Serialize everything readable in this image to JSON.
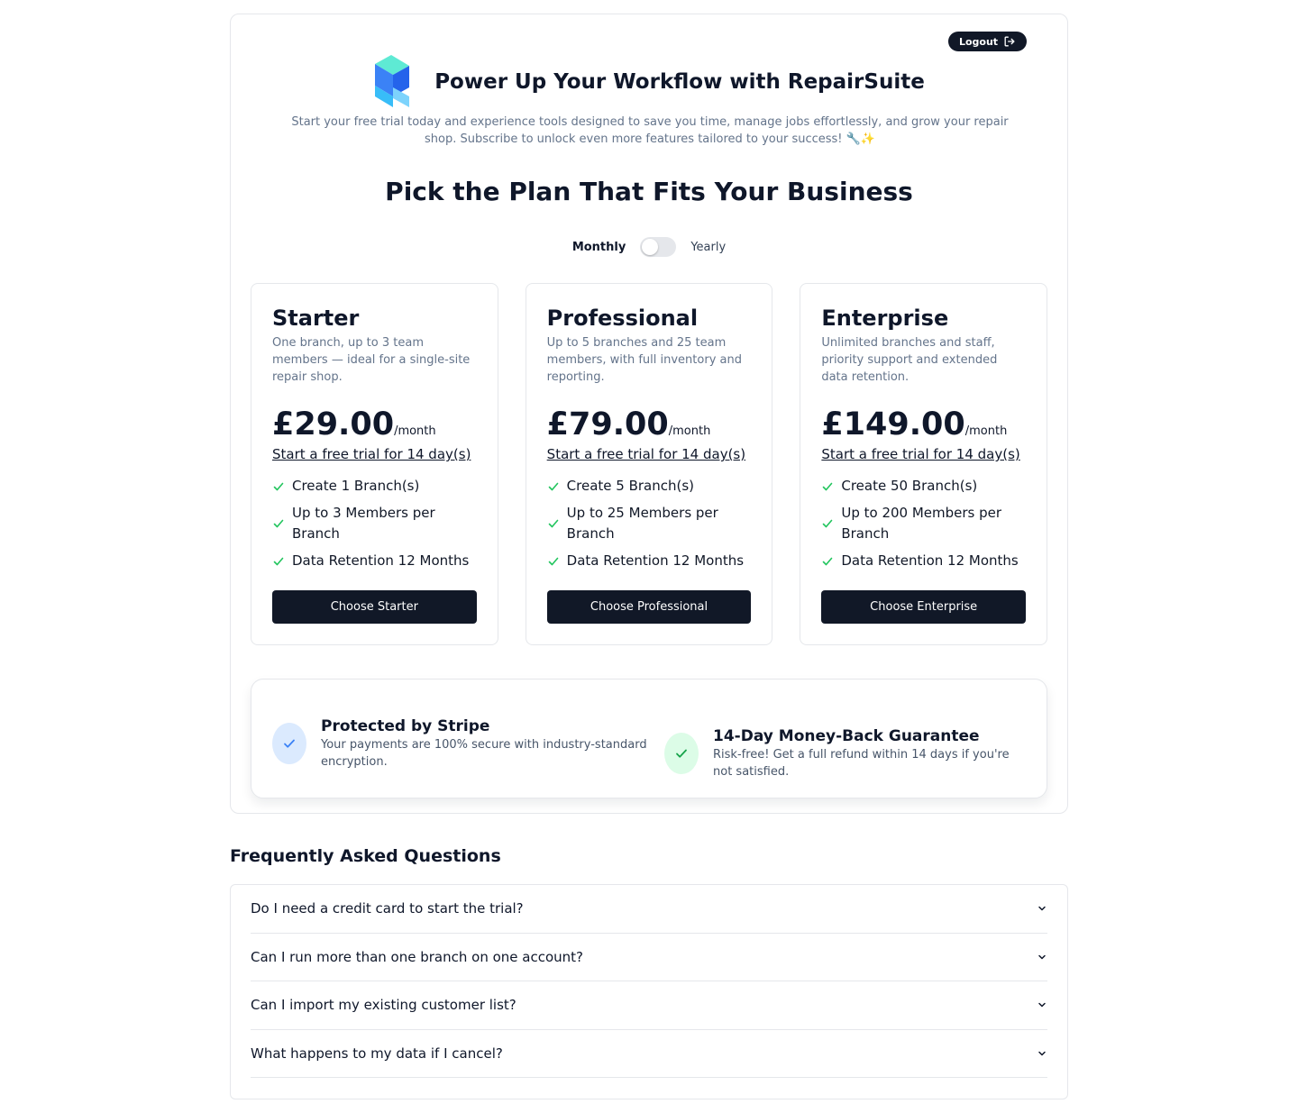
{
  "header": {
    "logout_label": "Logout",
    "brand_title": "Power Up Your Workflow with RepairSuite",
    "subtitle": "Start your free trial today and experience tools designed to save you time, manage jobs effortlessly, and grow your repair shop. Subscribe to unlock even more features tailored to your success! 🔧✨"
  },
  "pricing": {
    "title": "Pick the Plan That Fits Your Business",
    "toggle": {
      "monthly_label": "Monthly",
      "yearly_label": "Yearly",
      "yearly_selected": false
    },
    "plans": [
      {
        "name": "Starter",
        "description": "One branch, up to 3 team members — ideal for a single-site repair shop.",
        "price": "£29.00",
        "period": "/month",
        "trial_link": "Start a free trial for 14 day(s)",
        "features": [
          "Create 1 Branch(s)",
          "Up to 3 Members per Branch",
          "Data Retention 12 Months"
        ],
        "button_label": "Choose Starter"
      },
      {
        "name": "Professional",
        "description": "Up to 5 branches and 25 team members, with full inventory and reporting.",
        "price": "£79.00",
        "period": "/month",
        "trial_link": "Start a free trial for 14 day(s)",
        "features": [
          "Create 5 Branch(s)",
          "Up to 25 Members per Branch",
          "Data Retention 12 Months"
        ],
        "button_label": "Choose Professional"
      },
      {
        "name": "Enterprise",
        "description": "Unlimited branches and staff, priority support and extended data retention.",
        "price": "£149.00",
        "period": "/month",
        "trial_link": "Start a free trial for 14 day(s)",
        "features": [
          "Create 50 Branch(s)",
          "Up to 200 Members per Branch",
          "Data Retention 12 Months"
        ],
        "button_label": "Choose Enterprise"
      }
    ]
  },
  "trust": {
    "stripe": {
      "title": "Protected by Stripe",
      "text": "Your payments are 100% secure with industry-standard encryption."
    },
    "guarantee": {
      "title": "14-Day Money-Back Guarantee",
      "text": "Risk-free! Get a full refund within 14 days if you're not satisfied."
    }
  },
  "faq": {
    "title": "Frequently Asked Questions",
    "items": [
      {
        "question": "Do I need a credit card to start the trial?"
      },
      {
        "question": "Can I run more than one branch on one account?"
      },
      {
        "question": "Can I import my existing customer list?"
      },
      {
        "question": "What happens to my data if I cancel?"
      }
    ]
  },
  "colors": {
    "primary_dark": "#111827",
    "check_green": "#22c55e",
    "stripe_circle": "#dbeafe",
    "stripe_check": "#3b82f6",
    "guarantee_circle": "#dcfce7",
    "guarantee_check": "#16a34a",
    "logo_blue": "#2563eb",
    "logo_cyan": "#67e8f9"
  }
}
